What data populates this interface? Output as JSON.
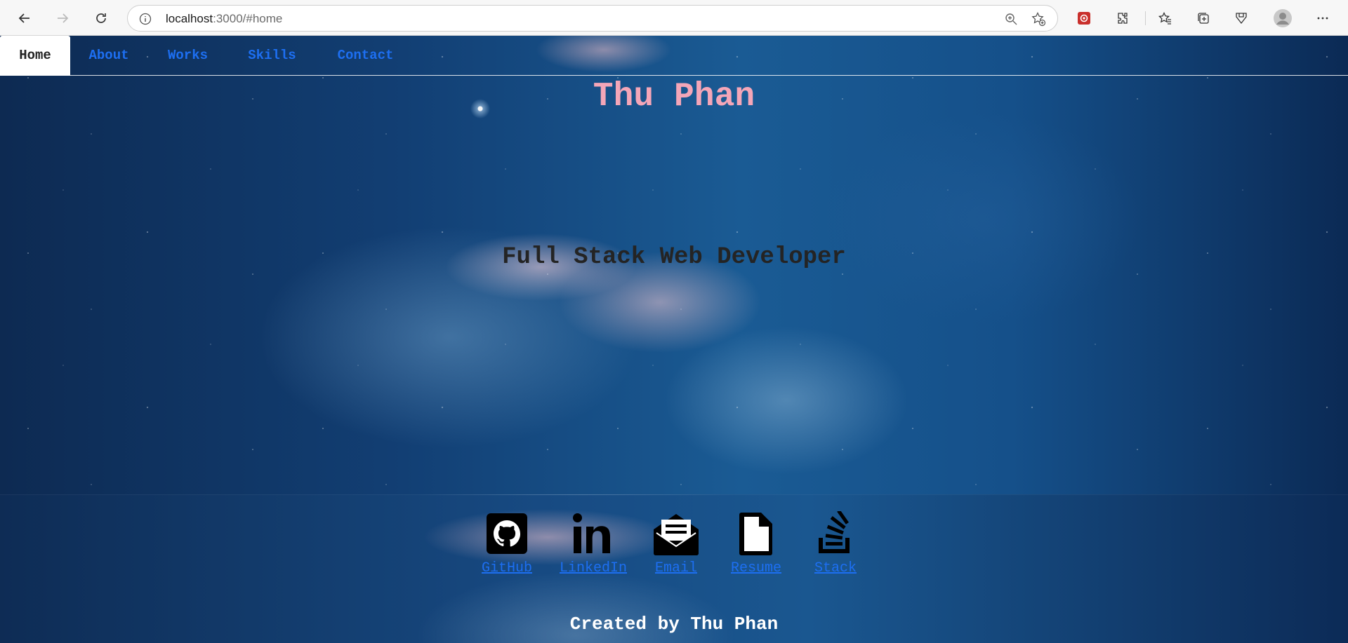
{
  "browser": {
    "url_host": "localhost",
    "url_rest": ":3000/#home",
    "icons": [
      "back-arrow-icon",
      "forward-arrow-icon",
      "reload-icon",
      "info-icon",
      "zoom-icon",
      "add-favorite-icon",
      "extension-badge-icon",
      "extensions-icon",
      "favorites-icon",
      "collections-icon",
      "performance-icon",
      "profile-icon",
      "more-icon"
    ]
  },
  "nav": {
    "items": [
      {
        "label": "Home",
        "active": true
      },
      {
        "label": "About",
        "active": false
      },
      {
        "label": "Works",
        "active": false
      },
      {
        "label": "Skills",
        "active": false
      },
      {
        "label": "Contact",
        "active": false
      }
    ]
  },
  "hero": {
    "name": "Thu Phan",
    "role": "Full Stack Web Developer"
  },
  "links": [
    {
      "label": "GitHub",
      "icon": "github-icon"
    },
    {
      "label": "LinkedIn",
      "icon": "linkedin-icon"
    },
    {
      "label": "Email",
      "icon": "email-icon"
    },
    {
      "label": "Resume",
      "icon": "file-icon"
    },
    {
      "label": "Stack",
      "icon": "stackoverflow-icon"
    }
  ],
  "footer": {
    "text": "Created by Thu Phan"
  },
  "colors": {
    "name": "#f4a6b8",
    "link": "#1d6ff2",
    "role": "#242424",
    "footer": "#ffffff"
  }
}
